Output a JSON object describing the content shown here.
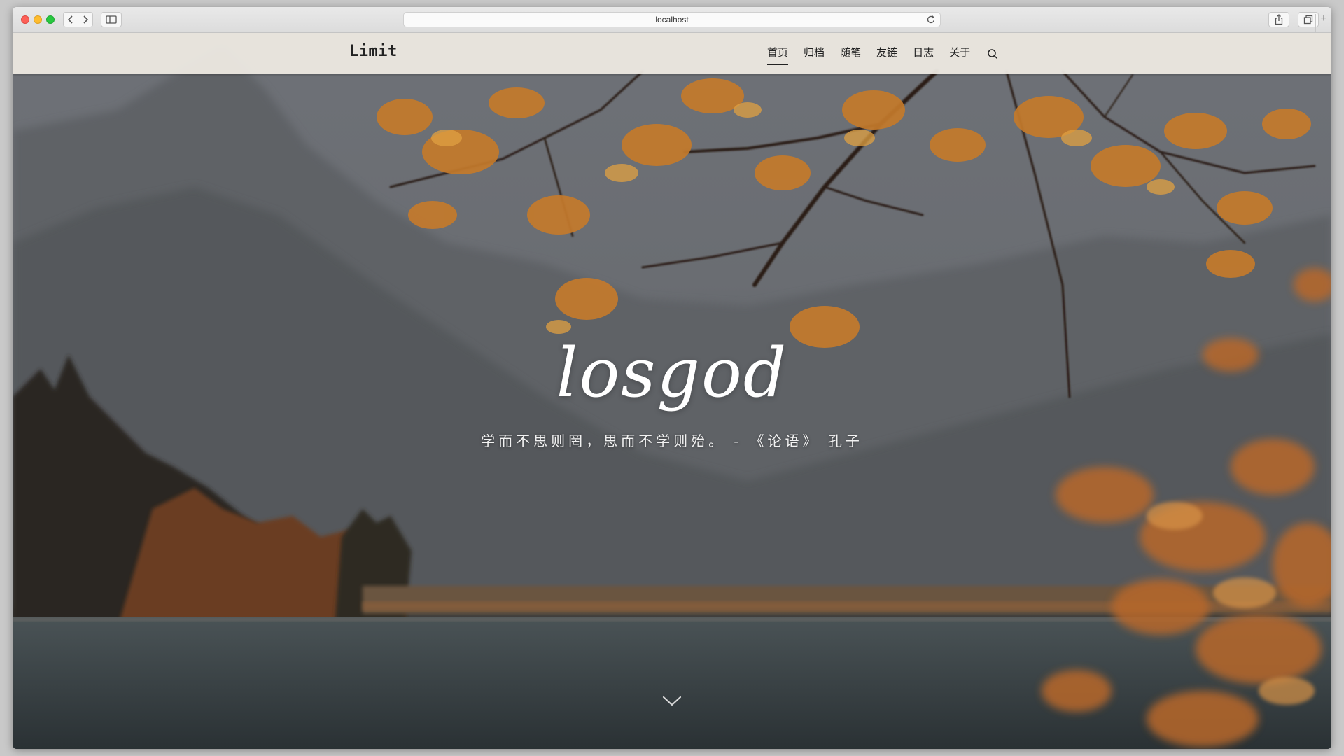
{
  "browser": {
    "address": "localhost",
    "new_tab_label": "+"
  },
  "site": {
    "logo": "Limit",
    "nav": [
      "首页",
      "归档",
      "随笔",
      "友链",
      "日志",
      "关于"
    ],
    "active_nav": "首页"
  },
  "hero": {
    "title": "losgod",
    "quote": "学而不思则罔，思而不学则殆。 - 《论语》 孔子"
  },
  "icons": {
    "search": "search-icon",
    "scroll_down": "chevron-down-icon",
    "back": "chevron-left-icon",
    "forward": "chevron-right-icon",
    "sidebar": "sidebar-icon",
    "reload": "reload-icon",
    "share": "share-icon",
    "tabs": "tabs-overview-icon"
  },
  "colors": {
    "header_bg": "#f0ece4",
    "text_dark": "#222222",
    "hero_text": "#ffffff",
    "foliage": "#c77a2a"
  }
}
